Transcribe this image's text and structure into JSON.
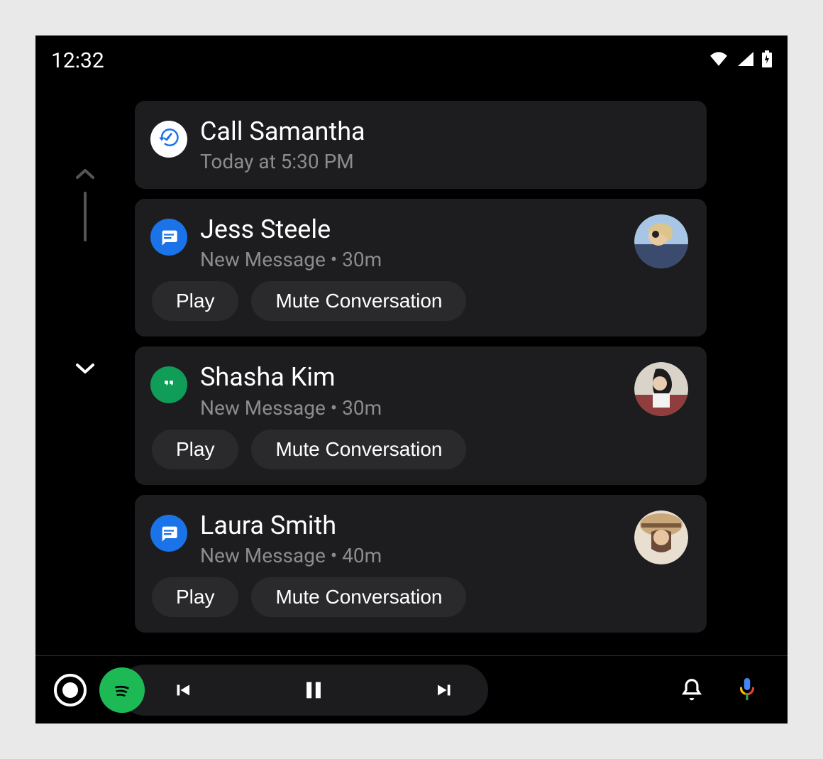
{
  "status": {
    "time": "12:32"
  },
  "cards": [
    {
      "app_icon": "reminder",
      "title": "Call Samantha",
      "subtitle": "Today at 5:30 PM",
      "has_avatar": false,
      "actions": []
    },
    {
      "app_icon": "messages",
      "title": "Jess Steele",
      "subtitle": "New Message • 30m",
      "has_avatar": true,
      "avatar_colors": [
        "#dbc58a",
        "#3a4b6e"
      ],
      "actions": [
        "Play",
        "Mute Conversation"
      ]
    },
    {
      "app_icon": "hangouts",
      "title": "Shasha Kim",
      "subtitle": "New Message • 30m",
      "has_avatar": true,
      "avatar_colors": [
        "#d9d3c9",
        "#8f3d3d"
      ],
      "actions": [
        "Play",
        "Mute Conversation"
      ]
    },
    {
      "app_icon": "messages",
      "title": "Laura Smith",
      "subtitle": "New Message • 40m",
      "has_avatar": true,
      "avatar_colors": [
        "#caa87c",
        "#6b4a3a"
      ],
      "actions": [
        "Play",
        "Mute Conversation"
      ]
    }
  ],
  "icons": {
    "reminder_bg": "#ffffff",
    "messages_bg": "#1a73e8",
    "hangouts_bg": "#0f9d58"
  }
}
